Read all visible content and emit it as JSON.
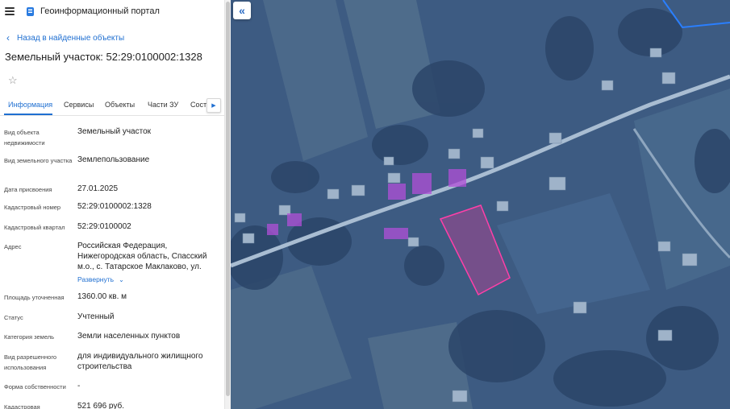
{
  "app": {
    "title": "Геоинформационный портал"
  },
  "nav": {
    "back_label": "Назад в найденные объекты"
  },
  "object": {
    "title": "Земельный участок: 52:29:0100002:1328"
  },
  "tabs": [
    {
      "label": "Информация",
      "active": true
    },
    {
      "label": "Сервисы"
    },
    {
      "label": "Объекты"
    },
    {
      "label": "Части ЗУ"
    },
    {
      "label": "Сост"
    }
  ],
  "details": [
    {
      "label": "Вид объекта недвижимости",
      "value": "Земельный участок"
    },
    {
      "label": "Вид земельного участка",
      "value": "Землепользование"
    },
    {
      "label": "Дата присвоения",
      "value": "27.01.2025"
    },
    {
      "label": "Кадастровый номер",
      "value": "52:29:0100002:1328"
    },
    {
      "label": "Кадастровый квартал",
      "value": "52:29:0100002"
    },
    {
      "label": "Адрес",
      "value": "Российская Федерация, Нижегородская область, Спасский м.о., с. Татарское Маклаково, ул.",
      "expand_label": "Развернуть"
    },
    {
      "label": "Площадь уточненная",
      "value": "1360.00 кв. м"
    },
    {
      "label": "Статус",
      "value": "Учтенный"
    },
    {
      "label": "Категория земель",
      "value": "Земли населенных пунктов"
    },
    {
      "label": "Вид разрешенного использования",
      "value": "для индивидуального жилищного строительства"
    },
    {
      "label": "Форма собственности",
      "value": "-"
    },
    {
      "label": "Кадастровая",
      "value": "521 696 руб."
    }
  ],
  "map": {
    "parcel_color": "#e0399a",
    "highlight_color": "#b24fd8",
    "boundary_color": "#2a7fff"
  }
}
